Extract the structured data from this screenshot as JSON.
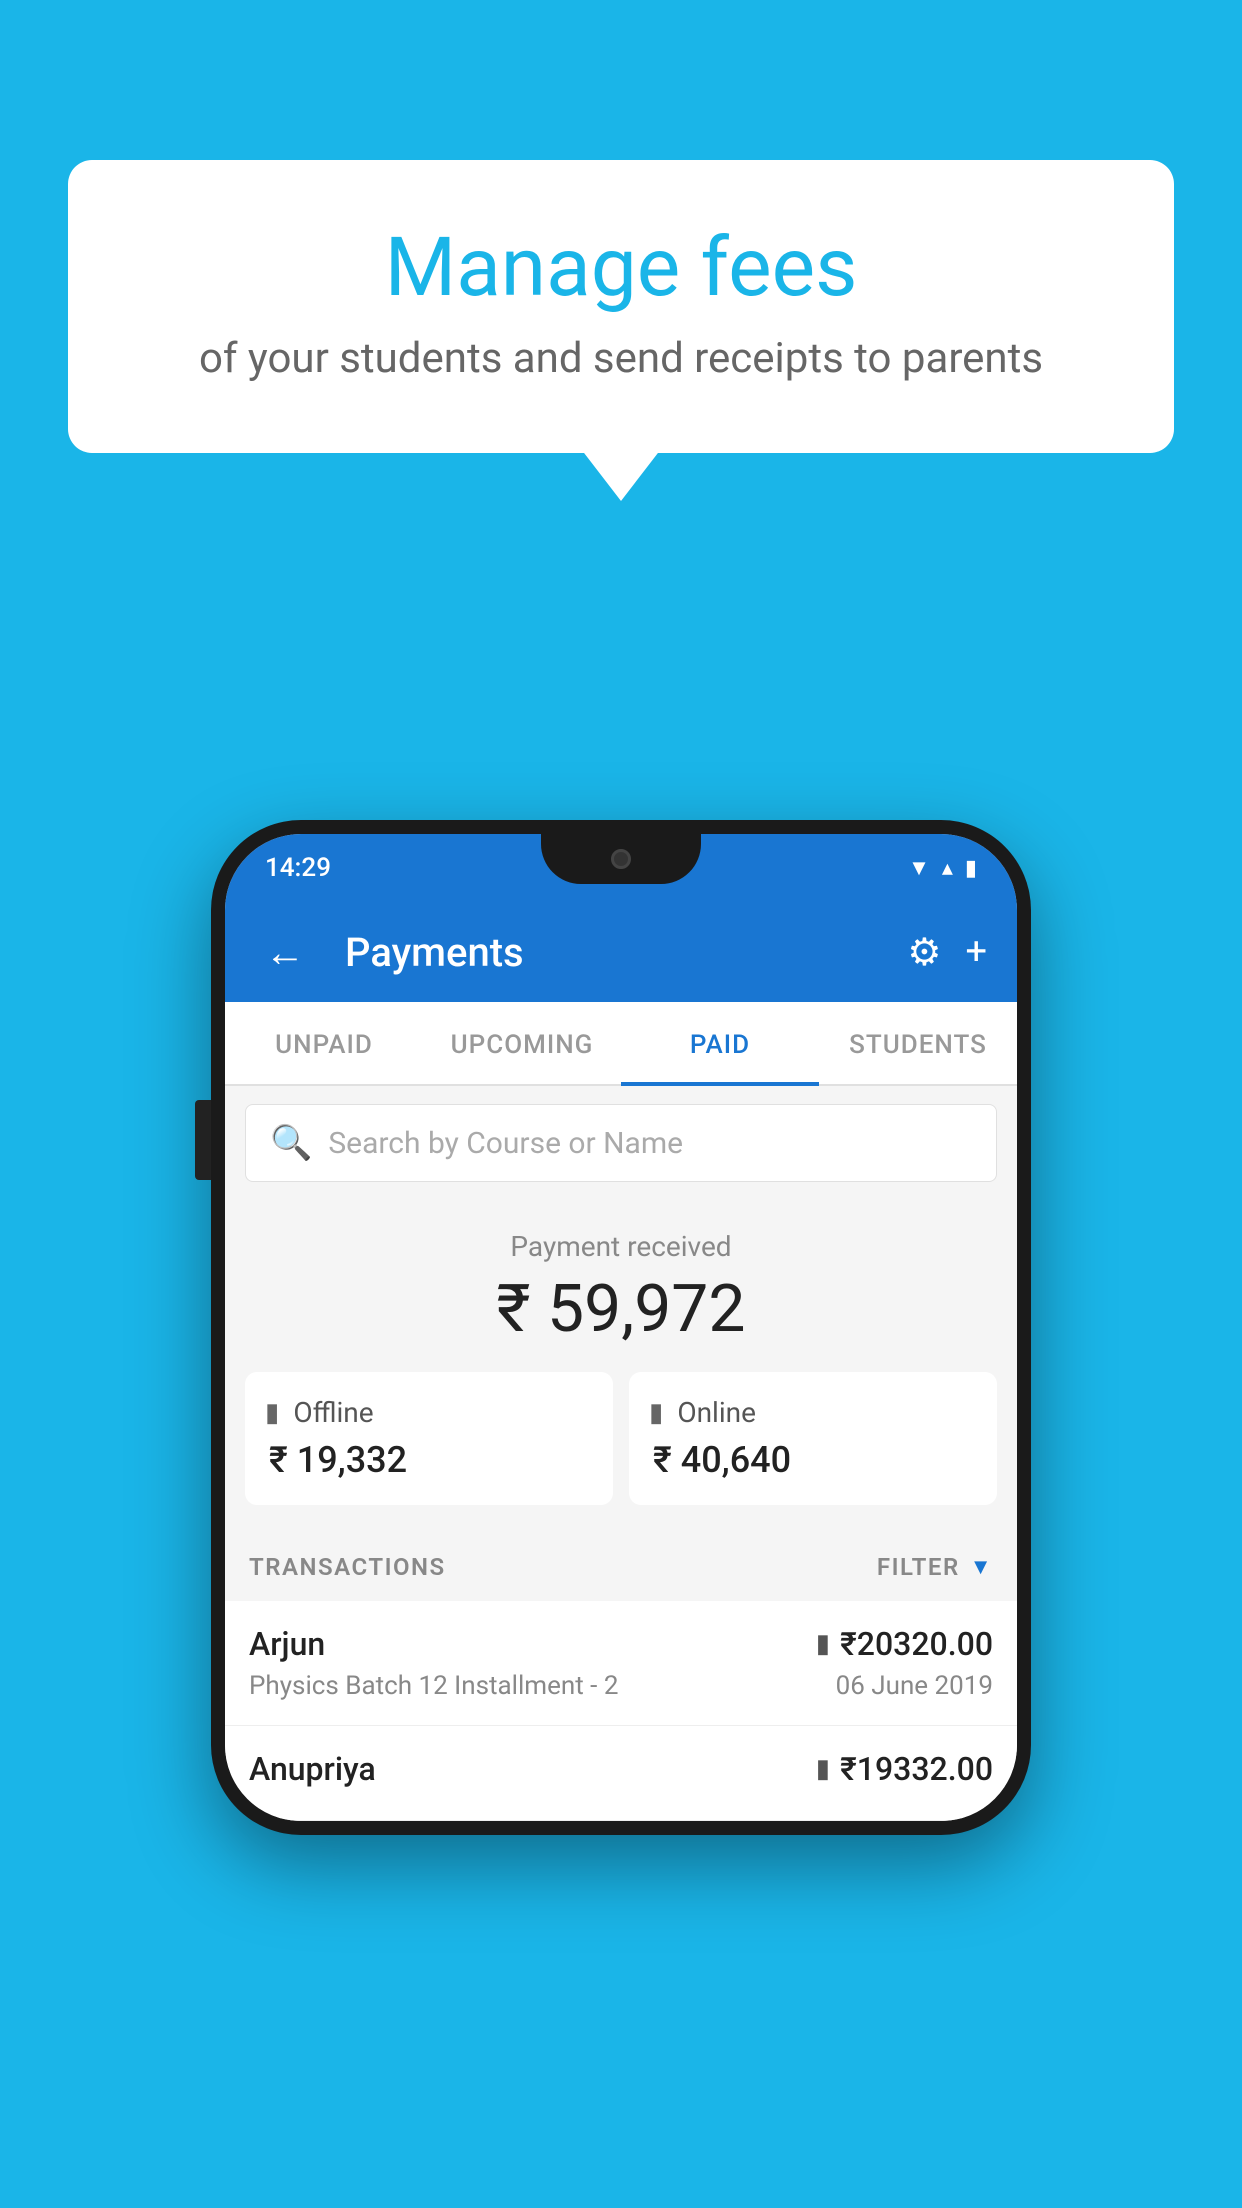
{
  "background_color": "#1ab5e8",
  "bubble": {
    "title": "Manage fees",
    "subtitle": "of your students and send receipts to parents"
  },
  "status_bar": {
    "time": "14:29",
    "wifi_icon": "▼",
    "signal_icon": "▲",
    "battery_icon": "▮"
  },
  "header": {
    "title": "Payments",
    "back_label": "←",
    "gear_icon": "⚙",
    "plus_icon": "+"
  },
  "tabs": [
    {
      "label": "UNPAID",
      "active": false
    },
    {
      "label": "UPCOMING",
      "active": false
    },
    {
      "label": "PAID",
      "active": true
    },
    {
      "label": "STUDENTS",
      "active": false
    }
  ],
  "search": {
    "placeholder": "Search by Course or Name"
  },
  "payment_received": {
    "label": "Payment received",
    "amount": "₹ 59,972",
    "offline": {
      "label": "Offline",
      "amount": "₹ 19,332"
    },
    "online": {
      "label": "Online",
      "amount": "₹ 40,640"
    }
  },
  "transactions": {
    "label": "TRANSACTIONS",
    "filter_label": "FILTER",
    "items": [
      {
        "name": "Arjun",
        "course": "Physics Batch 12 Installment - 2",
        "amount": "₹20320.00",
        "date": "06 June 2019",
        "payment_type": "online"
      },
      {
        "name": "Anupriya",
        "course": "",
        "amount": "₹19332.00",
        "date": "",
        "payment_type": "offline"
      }
    ]
  }
}
